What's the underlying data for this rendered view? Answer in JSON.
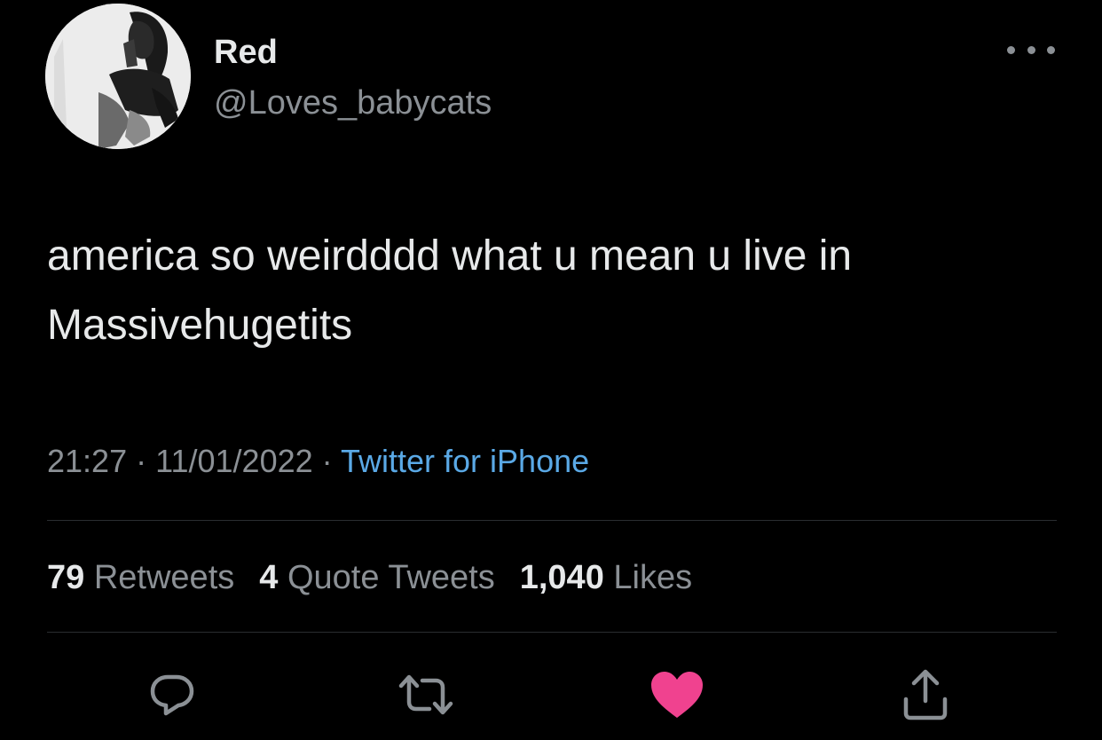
{
  "user": {
    "display_name": "Red",
    "handle": "@Loves_babycats"
  },
  "tweet": {
    "text": "america so weirdddd what u mean u live in Massivehugetits",
    "time": "21:27",
    "date": "11/01/2022",
    "separator": "·",
    "source": "Twitter for iPhone"
  },
  "stats": {
    "retweets_count": "79",
    "retweets_label": "Retweets",
    "quotes_count": "4",
    "quotes_label": "Quote Tweets",
    "likes_count": "1,040",
    "likes_label": "Likes"
  },
  "actions": {
    "reply_icon": "reply-icon",
    "retweet_icon": "retweet-icon",
    "like_icon": "heart-icon",
    "share_icon": "share-icon",
    "liked": true
  },
  "colors": {
    "background": "#000000",
    "text": "#e7e9ea",
    "secondary_text": "#8b9095",
    "link": "#5aa9e6",
    "like_active": "#f0428f"
  }
}
